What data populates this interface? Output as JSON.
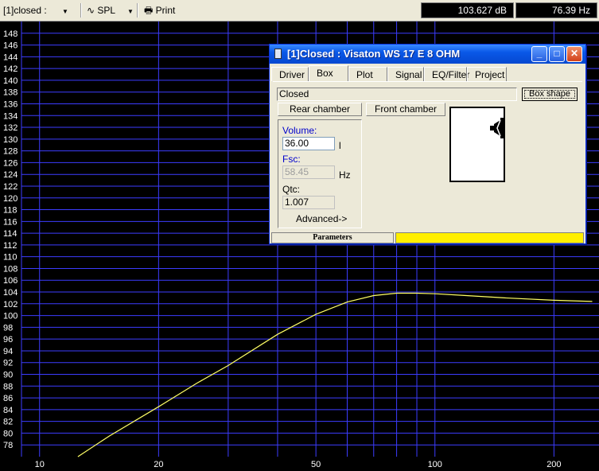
{
  "toolbar": {
    "project_selector": "[1]closed :",
    "plot_selector": "SPL",
    "print_label": "Print",
    "readout_level": "103.627 dB",
    "readout_freq": "76.39 Hz"
  },
  "chart_data": {
    "type": "line",
    "title": "",
    "xlabel": "",
    "ylabel": "",
    "x_scale": "log",
    "xlim": [
      9,
      260
    ],
    "ylim": [
      76,
      150
    ],
    "x_ticks": [
      10,
      20,
      50,
      100,
      200
    ],
    "x_tick_labels": [
      "10",
      "20",
      "50",
      "100",
      "200"
    ],
    "y_ticks": [
      78,
      80,
      82,
      84,
      86,
      88,
      90,
      92,
      94,
      96,
      98,
      100,
      102,
      104,
      106,
      108,
      110,
      112,
      114,
      116,
      118,
      120,
      122,
      124,
      126,
      128,
      130,
      132,
      134,
      136,
      138,
      140,
      142,
      144,
      146,
      148
    ],
    "grid": true,
    "colors": {
      "background": "#000000",
      "grid": "#3c3cff",
      "curve": "#ffff66",
      "axis_text": "#ffffff"
    },
    "series": [
      {
        "name": "",
        "x": [
          12.5,
          15,
          20,
          25,
          30,
          40,
          50,
          60,
          70,
          80,
          90,
          100,
          120,
          150,
          200,
          250
        ],
        "y": [
          76,
          79.5,
          84.5,
          88.5,
          91.5,
          96.8,
          100.2,
          102.3,
          103.4,
          103.8,
          103.8,
          103.7,
          103.4,
          103.0,
          102.6,
          102.4
        ]
      }
    ]
  },
  "dialog": {
    "title": "[1]Closed : Visaton WS 17 E 8 OHM",
    "tabs": [
      {
        "label": "Driver",
        "active": false
      },
      {
        "label": "Box",
        "active": true
      },
      {
        "label": "Plot",
        "active": false
      },
      {
        "label": "Signal",
        "active": false
      },
      {
        "label": "EQ/Filter",
        "active": false
      },
      {
        "label": "Project",
        "active": false
      }
    ],
    "box_type": "Closed",
    "box_shape_button": "Box shape",
    "rear_chamber_button": "Rear chamber",
    "front_chamber_button": "Front chamber",
    "volume_label": "Volume:",
    "volume_value": "36.00",
    "volume_unit": "l",
    "fsc_label": "Fsc:",
    "fsc_value": "58.45",
    "fsc_unit": "Hz",
    "qtc_label": "Qtc:",
    "qtc_value": "1.007",
    "advanced_label": "Advanced->",
    "status_text": "Parameters",
    "colors": {
      "titlebar": "#0a58e8",
      "status_bar": "#ffef00",
      "link_label": "#0000cc"
    }
  }
}
